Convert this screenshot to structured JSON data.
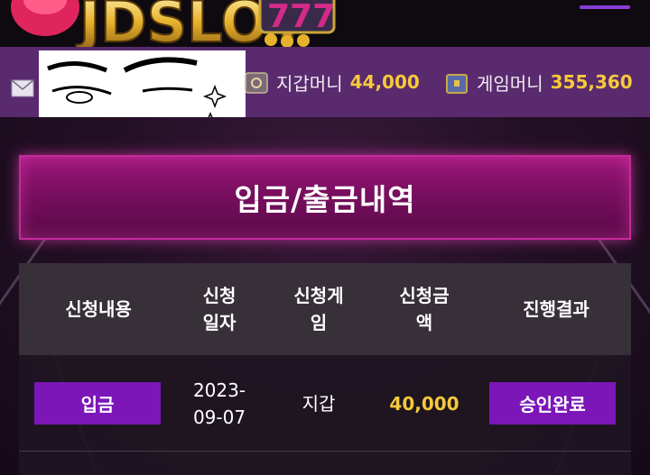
{
  "header": {
    "logo_text": "JDSLOT",
    "menu_icon": "hamburger-icon"
  },
  "statusbar": {
    "mail_icon": "mail-icon",
    "wallet": {
      "label": "지갑머니",
      "value": "44,000",
      "icon": "safe-icon"
    },
    "game": {
      "label": "게임머니",
      "value": "355,360",
      "icon": "treasure-box-icon"
    }
  },
  "page": {
    "title": "입금/출금내역"
  },
  "table": {
    "headers": [
      "신청내용",
      "신청\n일자",
      "신청게\n임",
      "신청금\n액",
      "진행결과"
    ],
    "rows": [
      {
        "type": "입금",
        "date": "2023-\n09-07",
        "game": "지갑",
        "amount": "40,000",
        "status": "승인완료"
      }
    ]
  },
  "colors": {
    "accent_purple": "#7c16b8",
    "gold": "#f6c93a",
    "title_magenta": "#a0177c",
    "statusbar_bg": "#5a2a6e"
  }
}
